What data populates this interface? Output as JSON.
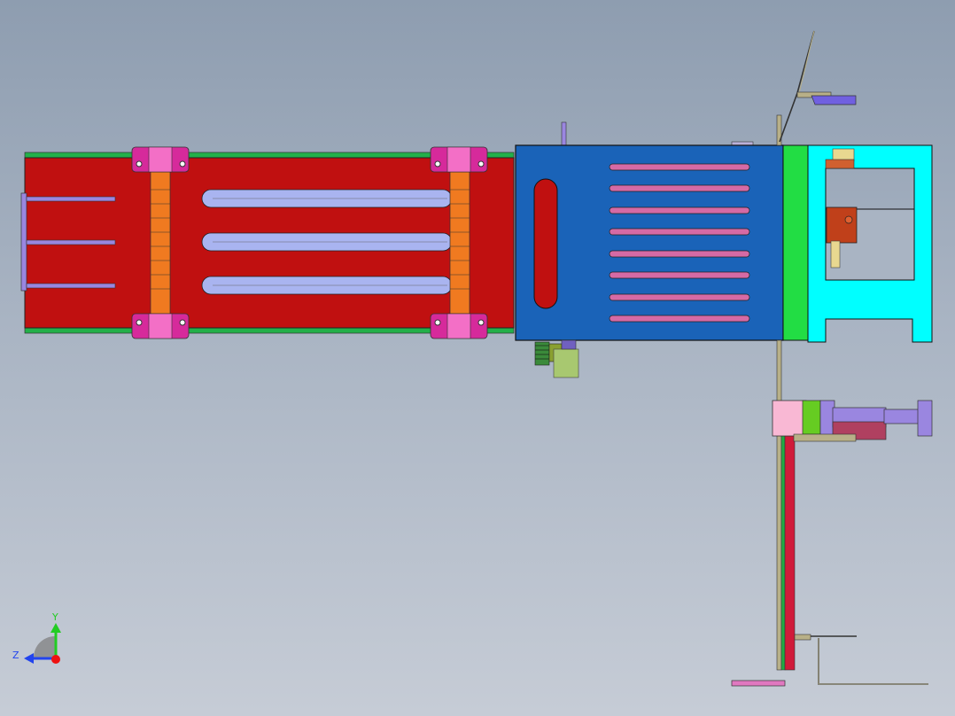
{
  "viewport": {
    "background_top": "#8e9db0",
    "background_bottom": "#c6ccd6"
  },
  "model": {
    "conveyor_color": "#c01010",
    "rail_color": "#22b04a",
    "slot_color": "#a9b4f0",
    "clamp_color": "#d62a9b",
    "roller_color": "#f07a20",
    "box_color": "#1a63b8",
    "box_slot_color": "#d56aa5",
    "flange_color": "#22dd44",
    "bracket_color": "#00ffff",
    "cylinder_color": "#9a86e0",
    "pink_block_color": "#f9b8d4"
  },
  "triad": {
    "y_label": "Y",
    "z_label": "Z",
    "y_color": "#22cc22",
    "z_color": "#2244ee",
    "origin_color": "#ee1111"
  }
}
